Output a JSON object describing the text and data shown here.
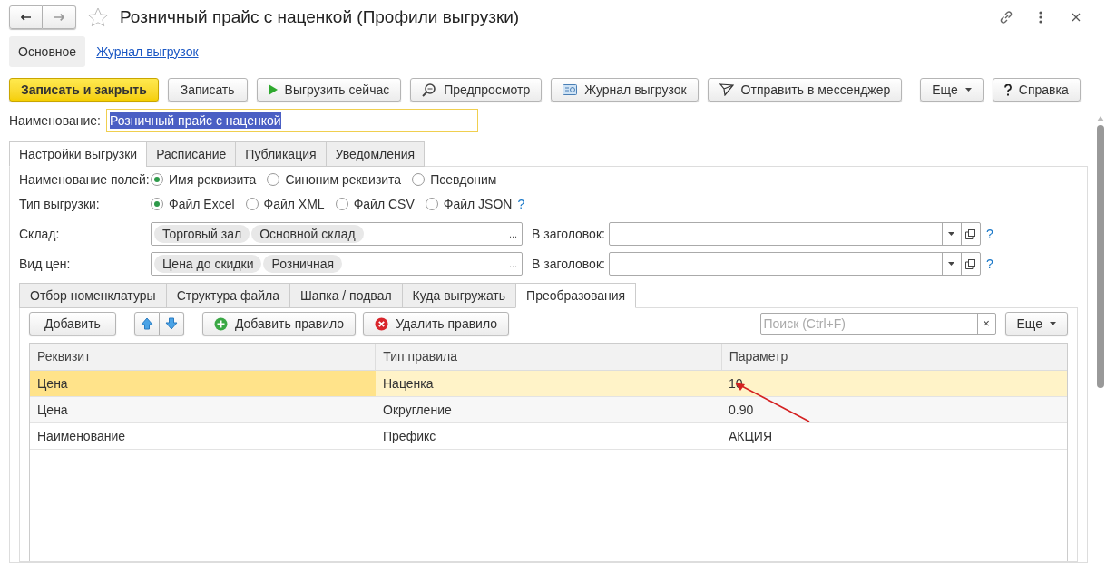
{
  "window": {
    "title": "Розничный прайс с наценкой (Профили выгрузки)"
  },
  "sections": [
    {
      "label": "Основное",
      "selected": true
    },
    {
      "label": "Журнал выгрузок",
      "selected": false
    }
  ],
  "commands": [
    {
      "label": "Записать и закрыть",
      "kind": "primary"
    },
    {
      "label": "Записать",
      "kind": "plain"
    },
    {
      "label": "Выгрузить сейчас",
      "kind": "play"
    },
    {
      "label": "Предпросмотр",
      "kind": "preview"
    },
    {
      "label": "Журнал выгрузок",
      "kind": "journal"
    },
    {
      "label": "Отправить в мессенджер",
      "kind": "send"
    }
  ],
  "commands_right": [
    {
      "label": "Еще",
      "kind": "menu"
    },
    {
      "label": "Справка",
      "kind": "help"
    }
  ],
  "name_field": {
    "label": "Наименование:",
    "value": "Розничный прайс с наценкой",
    "selected": true
  },
  "tabs": [
    {
      "label": "Настройки выгрузки",
      "selected": true
    },
    {
      "label": "Расписание",
      "selected": false
    },
    {
      "label": "Публикация",
      "selected": false
    },
    {
      "label": "Уведомления",
      "selected": false
    }
  ],
  "radio_groups": [
    {
      "label": "Наименование полей:",
      "options": [
        {
          "label": "Имя реквизита",
          "selected": true
        },
        {
          "label": "Синоним реквизита",
          "selected": false
        },
        {
          "label": "Псевдоним",
          "selected": false
        }
      ]
    },
    {
      "label": "Тип выгрузки:",
      "options": [
        {
          "label": "Файл Excel",
          "selected": true
        },
        {
          "label": "Файл XML",
          "selected": false
        },
        {
          "label": "Файл CSV",
          "selected": false
        },
        {
          "label": "Файл JSON",
          "selected": false
        }
      ],
      "help": "?"
    }
  ],
  "tag_fields": [
    {
      "label": "Склад:",
      "tags": [
        "Торговый зал",
        "Основной склад"
      ],
      "choose": "...",
      "header_label": "В заголовок:",
      "help": "?"
    },
    {
      "label": "Вид цен:",
      "tags": [
        "Цена до скидки",
        "Розничная"
      ],
      "choose": "...",
      "header_label": "В заголовок:",
      "help": "?"
    }
  ],
  "inner_tabs": [
    {
      "label": "Отбор номенклатуры",
      "selected": false
    },
    {
      "label": "Структура файла",
      "selected": false
    },
    {
      "label": "Шапка / подвал",
      "selected": false
    },
    {
      "label": "Куда выгружать",
      "selected": false
    },
    {
      "label": "Преобразования",
      "selected": true
    }
  ],
  "rules_toolbar": [
    {
      "kind": "plain",
      "label": "Добавить"
    },
    {
      "kind": "up"
    },
    {
      "kind": "down"
    },
    {
      "kind": "add",
      "label": "Добавить правило"
    },
    {
      "kind": "delete",
      "label": "Удалить правило"
    }
  ],
  "search": {
    "placeholder": "Поиск (Ctrl+F)",
    "clear": "×"
  },
  "more": {
    "label": "Еще"
  },
  "table": {
    "columns": [
      "Реквизит",
      "Тип правила",
      "Параметр"
    ],
    "rows": [
      {
        "cells": [
          "Цена",
          "Наценка",
          "10"
        ],
        "selected": true
      },
      {
        "cells": [
          "Цена",
          "Округление",
          "0.90"
        ],
        "selected": false
      },
      {
        "cells": [
          "Наименование",
          "Префикс",
          "АКЦИЯ"
        ],
        "selected": false
      }
    ]
  }
}
